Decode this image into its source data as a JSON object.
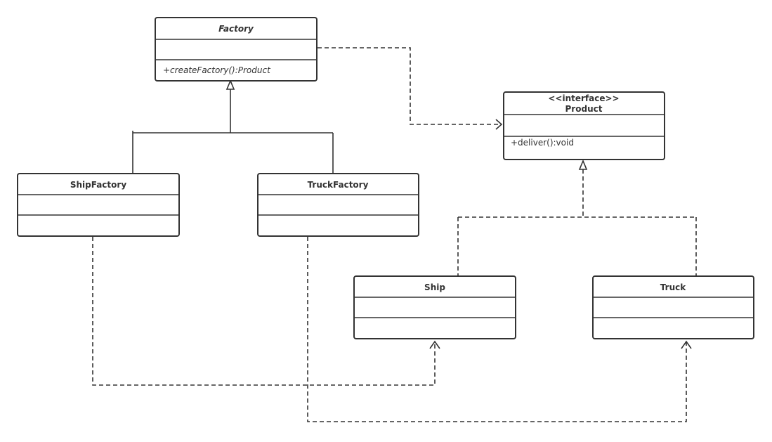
{
  "classes": {
    "factory": {
      "name": "Factory",
      "method": "+createFactory():Product"
    },
    "product": {
      "stereotype": "<<interface>>",
      "name": "Product",
      "method": "+deliver():void"
    },
    "ship_factory": {
      "name": "ShipFactory"
    },
    "truck_factory": {
      "name": "TruckFactory"
    },
    "ship": {
      "name": "Ship"
    },
    "truck": {
      "name": "Truck"
    }
  },
  "colors": {
    "stroke": "#333333",
    "background": "#ffffff"
  }
}
